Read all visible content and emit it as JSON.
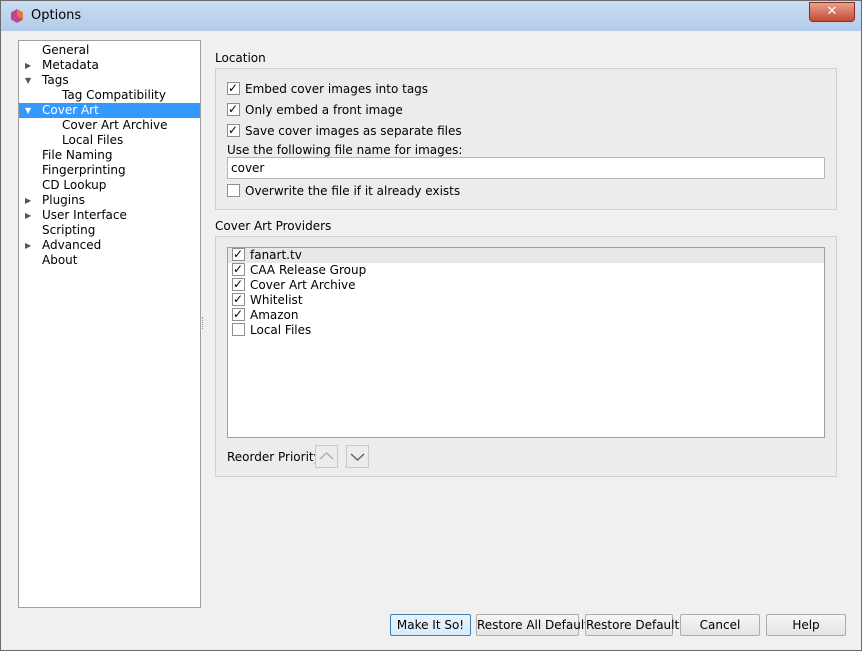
{
  "window": {
    "title": "Options",
    "close_label": "✕"
  },
  "tree": {
    "items": [
      {
        "label": "General",
        "level": 0,
        "arrow": ""
      },
      {
        "label": "Metadata",
        "level": 0,
        "arrow": "▶"
      },
      {
        "label": "Tags",
        "level": 0,
        "arrow": "▼"
      },
      {
        "label": "Tag Compatibility",
        "level": 1,
        "arrow": ""
      },
      {
        "label": "Cover Art",
        "level": 0,
        "arrow": "▼",
        "selected": true
      },
      {
        "label": "Cover Art Archive",
        "level": 1,
        "arrow": ""
      },
      {
        "label": "Local Files",
        "level": 1,
        "arrow": ""
      },
      {
        "label": "File Naming",
        "level": 0,
        "arrow": ""
      },
      {
        "label": "Fingerprinting",
        "level": 0,
        "arrow": ""
      },
      {
        "label": "CD Lookup",
        "level": 0,
        "arrow": ""
      },
      {
        "label": "Plugins",
        "level": 0,
        "arrow": "▶"
      },
      {
        "label": "User Interface",
        "level": 0,
        "arrow": "▶"
      },
      {
        "label": "Scripting",
        "level": 0,
        "arrow": ""
      },
      {
        "label": "Advanced",
        "level": 0,
        "arrow": "▶"
      },
      {
        "label": "About",
        "level": 0,
        "arrow": ""
      }
    ]
  },
  "location": {
    "title": "Location",
    "embed_label": "Embed cover images into tags",
    "embed_checked": true,
    "front_label": "Only embed a front image",
    "front_checked": true,
    "save_label": "Save cover images as separate files",
    "save_checked": true,
    "filename_label": "Use the following file name for images:",
    "filename_value": "cover",
    "overwrite_label": "Overwrite the file if it already exists",
    "overwrite_checked": false
  },
  "providers": {
    "title": "Cover Art Providers",
    "items": [
      {
        "label": "fanart.tv",
        "checked": true
      },
      {
        "label": "CAA Release Group",
        "checked": true
      },
      {
        "label": "Cover Art Archive",
        "checked": true
      },
      {
        "label": "Whitelist",
        "checked": true
      },
      {
        "label": "Amazon",
        "checked": true
      },
      {
        "label": "Local Files",
        "checked": false
      }
    ],
    "reorder_label": "Reorder Priority:"
  },
  "buttons": {
    "make_it_so": "Make It So!",
    "restore_all": "Restore All Defaults",
    "restore": "Restore Defaults",
    "cancel": "Cancel",
    "help": "Help"
  }
}
